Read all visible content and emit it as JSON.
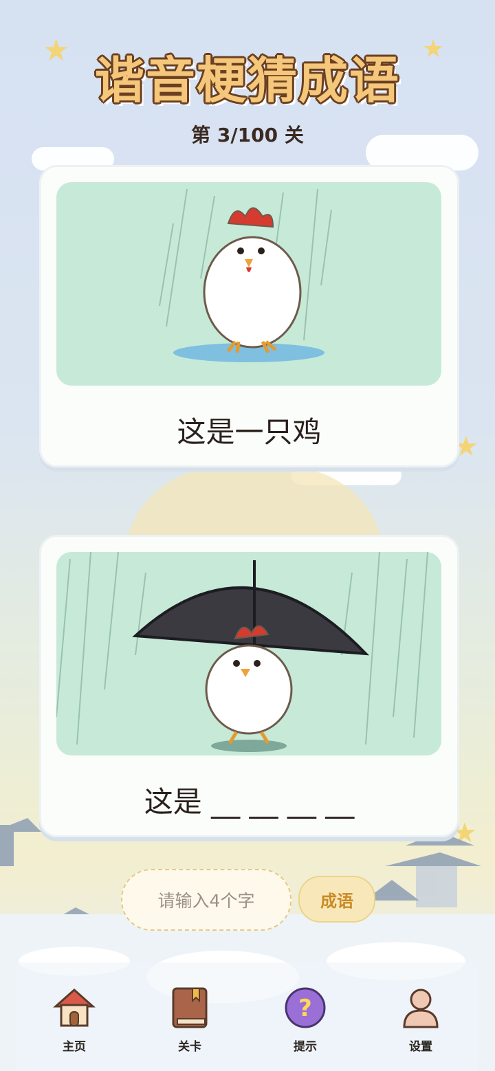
{
  "header": {
    "title": "谐音梗猜成语",
    "level": "第 3/100 关"
  },
  "cards": [
    {
      "caption": "这是一只鸡"
    },
    {
      "caption": "这是 __ __ __ __"
    }
  ],
  "answer": {
    "placeholder": "请输入4个字",
    "submit_label": "成语"
  },
  "nav": [
    {
      "label": "主页",
      "icon": "home-icon"
    },
    {
      "label": "关卡",
      "icon": "book-icon"
    },
    {
      "label": "提示",
      "icon": "hint-icon"
    },
    {
      "label": "设置",
      "icon": "profile-icon"
    }
  ],
  "colors": {
    "accent": "#f4c77a",
    "title_outline": "#6b3f22",
    "card_bg": "#c6ead7",
    "hint_purple": "#9a6fd6"
  }
}
